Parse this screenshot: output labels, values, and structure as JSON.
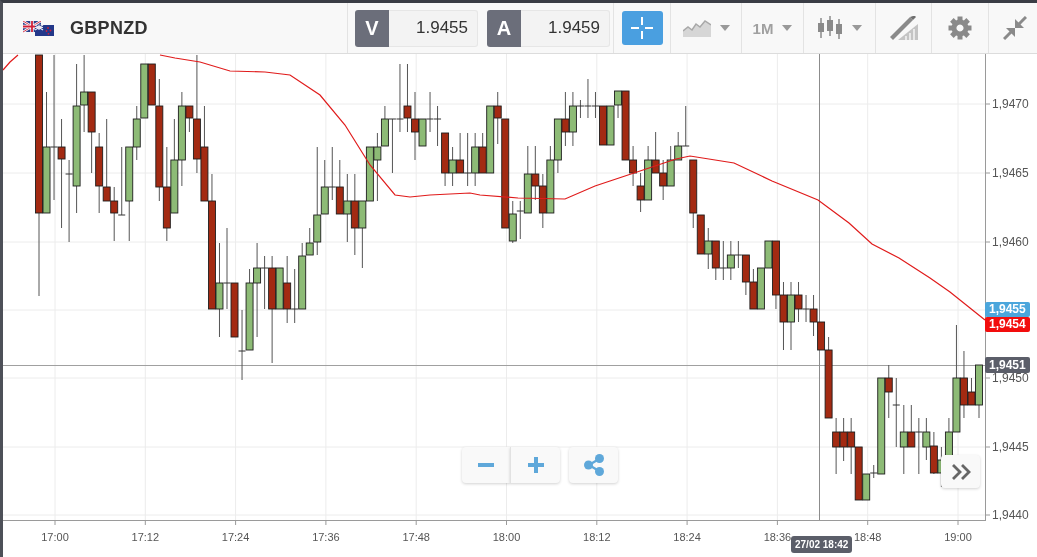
{
  "instrument": {
    "symbol": "GBPNZD"
  },
  "quotes": [
    {
      "label": "V",
      "value": "1.9455"
    },
    {
      "label": "A",
      "value": "1.9459"
    }
  ],
  "crosshair_button": {
    "on": true
  },
  "tools": [
    {
      "kind": "chart-type",
      "dropdown": true
    },
    {
      "kind": "timeframe",
      "label": "1M",
      "dropdown": true
    },
    {
      "kind": "candle-style",
      "dropdown": true
    },
    {
      "kind": "draw",
      "dropdown": false
    },
    {
      "kind": "settings",
      "dropdown": false
    },
    {
      "kind": "collapse",
      "dropdown": false
    }
  ],
  "chart": {
    "price_axis": [
      "1,9470",
      "1,9465",
      "1,9460",
      "1,9450",
      "1,9445",
      "1,9440"
    ],
    "time_axis": [
      "17:00",
      "17:12",
      "17:24",
      "17:36",
      "17:48",
      "18:00",
      "18:12",
      "18:24",
      "18:36",
      "18:48",
      "19:00"
    ],
    "price_labels": [
      {
        "text": "1,9455",
        "color": "#4ba6dc"
      },
      {
        "text": "1,9454",
        "color": "#f20d0d"
      },
      {
        "text": "1,9451",
        "color": "#5b5e69"
      }
    ],
    "crosshair_time": "27/02 18:42"
  }
}
